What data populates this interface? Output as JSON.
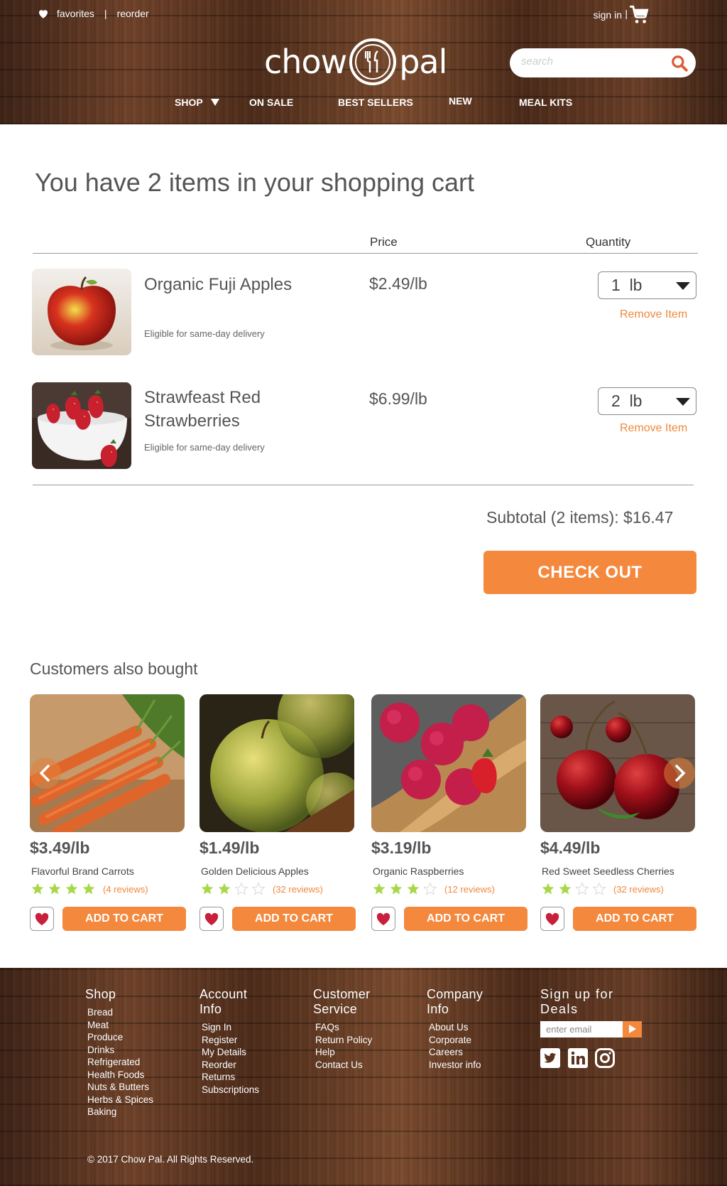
{
  "header": {
    "favorites": "favorites",
    "separator": "|",
    "reorder": "reorder",
    "sign_in": "sign in",
    "sign_in_sep": "|",
    "logo_left": "chow",
    "logo_right": "pal",
    "search_placeholder": "search",
    "nav": [
      "SHOP",
      "ON SALE",
      "BEST SELLERS",
      "NEW",
      "MEAL KITS"
    ]
  },
  "cart": {
    "title": "You have 2 items in your shopping cart",
    "col_price": "Price",
    "col_quantity": "Quantity",
    "items": [
      {
        "name": "Organic Fuji Apples",
        "note": "Eligible for same-day delivery",
        "price": "$2.49/lb",
        "qty": "1  lb",
        "remove": "Remove Item"
      },
      {
        "name": "Strawfeast Red Strawberries",
        "note": "Eligible for same-day delivery",
        "price": "$6.99/lb",
        "qty": "2  lb",
        "remove": "Remove Item"
      }
    ],
    "subtotal": "Subtotal (2 items): $16.47",
    "checkout": "CHECK OUT"
  },
  "recs": {
    "title": "Customers also bought",
    "add_label": "ADD TO CART",
    "items": [
      {
        "price": "$3.49/lb",
        "name": "Flavorful Brand Carrots",
        "rating": 4,
        "reviews": "(4 reviews)"
      },
      {
        "price": "$1.49/lb",
        "name": "Golden Delicious Apples",
        "rating": 2,
        "reviews": "(32 reviews)"
      },
      {
        "price": "$3.19/lb",
        "name": "Organic Raspberries",
        "rating": 3,
        "reviews": "(12 reviews)"
      },
      {
        "price": "$4.49/lb",
        "name": "Red Sweet Seedless Cherries",
        "rating": 2,
        "reviews": "(32 reviews)"
      }
    ]
  },
  "footer": {
    "shop": {
      "title": "Shop",
      "items": [
        "Bread",
        "Meat",
        "Produce",
        "Drinks",
        "Refrigerated",
        "Health Foods",
        "Nuts & Butters",
        "Herbs & Spices",
        "Baking"
      ]
    },
    "account": {
      "title1": "Account",
      "title2": "Info",
      "items": [
        "Sign In",
        "Register",
        "My Details",
        "Reorder",
        "Returns",
        "Subscriptions"
      ]
    },
    "service": {
      "title1": "Customer",
      "title2": "Service",
      "items": [
        "FAQs",
        "Return Policy",
        "Help",
        "Contact Us"
      ]
    },
    "company": {
      "title1": "Company",
      "title2": "Info",
      "items": [
        "About Us",
        "Corporate",
        "Careers",
        "Investor info"
      ]
    },
    "deals": {
      "title1": "Sign up for",
      "title2": "Deals",
      "email_placeholder": "enter email"
    },
    "copyright": "© 2017 Chow Pal.  All Rights Reserved."
  },
  "colors": {
    "accent": "#f4883c",
    "star": "#a8d84a",
    "star_empty": "#d8d8d8"
  },
  "icons": [
    "heart-icon",
    "cart-icon",
    "search-icon",
    "fork-knife-icon",
    "chevron-down-icon",
    "star-icon",
    "chevron-left-icon",
    "chevron-right-icon",
    "twitter-icon",
    "linkedin-icon",
    "instagram-icon",
    "play-icon"
  ]
}
